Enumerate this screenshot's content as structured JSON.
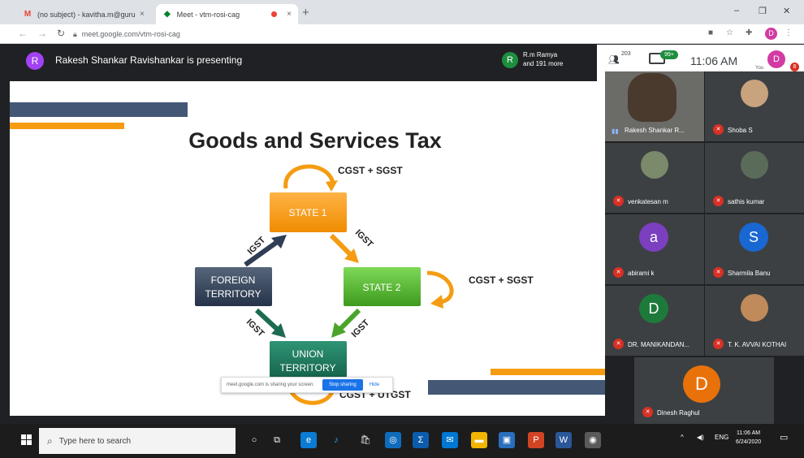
{
  "browser": {
    "tabs": [
      {
        "title": "(no subject) - kavitha.m@guruna",
        "icon": "gmail-icon"
      },
      {
        "title": "Meet - vtm-rosi-cag",
        "icon": "meet-icon"
      }
    ],
    "tab_close": "×",
    "new_tab": "+",
    "url": "meet.google.com/vtm-rosi-cag",
    "window_controls": [
      "–",
      "❐",
      "✕"
    ],
    "profile_initial": "D"
  },
  "meet": {
    "presenter_initial": "R",
    "presenter_text": "Rakesh Shankar Ravishankar is presenting",
    "pinned_initial": "R",
    "pinned_name": "R.m Ramya",
    "pinned_more": "and 191 more",
    "participant_count": "203",
    "chat_badge": "99+",
    "time": "11:06 AM",
    "you_label": "You",
    "you_initial": "D",
    "you_badge": "8"
  },
  "slide": {
    "title": "Goods and Services Tax",
    "state1": "STATE 1",
    "state2": "STATE 2",
    "foreign_line1": "FOREIGN",
    "foreign_line2": "TERRITORY",
    "union_line1": "UNION",
    "union_line2": "TERRITORY",
    "label_top": "CGST + SGST",
    "label_right": "CGST + SGST",
    "label_bottom": "CGST + UTGST",
    "igst": "IGST"
  },
  "share_bar": {
    "message": "meet.google.com is sharing your screen.",
    "stop": "Stop sharing",
    "hide": "Hide"
  },
  "participants": [
    {
      "name": "Rakesh Shankar R...",
      "initial": "",
      "color": "#6b6b68",
      "muted": false
    },
    {
      "name": "Shoba S",
      "initial": "",
      "color": "#c9a27e",
      "muted": true
    },
    {
      "name": "venkatesan m",
      "initial": "",
      "color": "#7a8a6a",
      "muted": true
    },
    {
      "name": "sathis kumar",
      "initial": "",
      "color": "#5b6b5a",
      "muted": true
    },
    {
      "name": "abirami k",
      "initial": "a",
      "color": "#7b3fbf",
      "muted": true
    },
    {
      "name": "Sharmila Banu",
      "initial": "S",
      "color": "#1967d2",
      "muted": true
    },
    {
      "name": "DR. MANIKANDAN...",
      "initial": "D",
      "color": "#1e7a3b",
      "muted": true
    },
    {
      "name": "T. K. AVVAI KOTHAI",
      "initial": "",
      "color": "#c08a5a",
      "muted": true
    },
    {
      "name": "Dinesh Raghul",
      "initial": "D",
      "color": "#e8710a",
      "muted": true
    }
  ],
  "taskbar": {
    "search_placeholder": "Type here to search",
    "tray_lang": "ENG",
    "tray_time": "11:06 AM",
    "tray_date": "6/24/2020"
  }
}
